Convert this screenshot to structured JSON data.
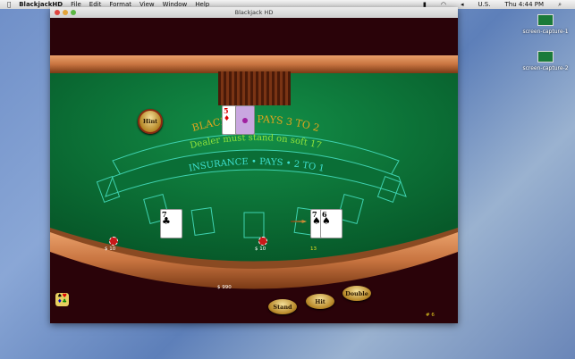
{
  "menubar": {
    "apple": "",
    "app": "BlackjackHD",
    "items": [
      "File",
      "Edit",
      "Format",
      "View",
      "Window",
      "Help"
    ],
    "input": "U.S.",
    "clock": "Thu 4:44 PM"
  },
  "desktop": {
    "icons": [
      {
        "label": "screen-capture-1"
      },
      {
        "label": "screen-capture-2"
      }
    ]
  },
  "window": {
    "title": "Blackjack HD"
  },
  "table": {
    "line1": "BLACKJACK   PAYS 3 TO 2",
    "line2": "Dealer must stand on soft 17",
    "line3": "INSURANCE  •  PAYS  •  2 TO 1",
    "felt_color": "#0d7a3c"
  },
  "dealer": {
    "cards": [
      {
        "rank": "5",
        "suit": "♦",
        "color": "#d00"
      }
    ],
    "hidden_cards": 1
  },
  "hint_label": "Hint",
  "spots": [
    {
      "bet": "$ 10",
      "cards": [
        {
          "rank": "7",
          "suit": "♣"
        }
      ]
    },
    {
      "bet": "$ 10",
      "cards": [
        {
          "rank": "7",
          "suit": "♠"
        },
        {
          "rank": "6",
          "suit": "♠"
        }
      ],
      "total": "13",
      "active": true
    }
  ],
  "bankroll": "$ 990",
  "buttons": {
    "stand": "Stand",
    "hit": "Hit",
    "double": "Double"
  },
  "round": "# 6"
}
